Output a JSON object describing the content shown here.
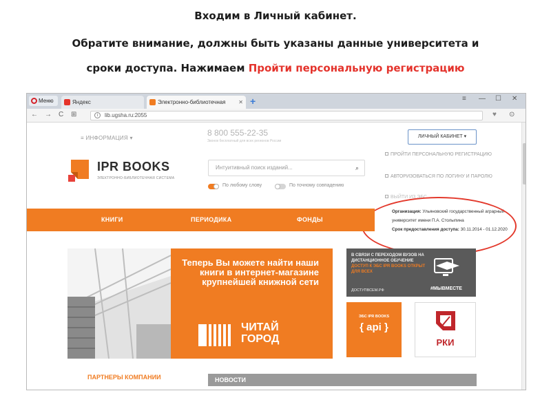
{
  "slide": {
    "line1": "Входим в Личный кабинет.",
    "line2": "Обратите внимание, должны быть указаны данные университета и",
    "line3_plain": "сроки доступа. Нажимаем ",
    "line3_accent": "Пройти персональную регистрацию"
  },
  "browser": {
    "menu_label": "Меню",
    "tabs": [
      {
        "label": "Яндекс",
        "active": false
      },
      {
        "label": "Электронно-библиотечная",
        "active": true
      }
    ],
    "new_tab": "+",
    "url": "lib.ugsha.ru:2055"
  },
  "site": {
    "info_menu": "≡ ИНФОРМАЦИЯ ▾",
    "phone": "8 800 555-22-35",
    "phone_note": "Звонок бесплатный для всех регионов России",
    "cabinet_button": "ЛИЧНЫЙ КАБИНЕТ ▾",
    "logo": "IPR BOOKS",
    "logo_sub": "ЭЛЕКТРОННО-БИБЛИОТЕЧНАЯ СИСТЕМА",
    "search_placeholder": "Интуитивный поиск изданий...",
    "toggle_any": "По любому слову",
    "toggle_exact": "По точному совпадению",
    "dropdown": [
      "ПРОЙТИ ПЕРСОНАЛЬНУЮ РЕГИСТРАЦИЮ",
      "АВТОРИЗОВАТЬСЯ ПО ЛОГИНУ И ПАРОЛЮ",
      "ВЫЙТИ ИЗ ЭБС"
    ],
    "org_label": "Организация:",
    "org_value": "Ульяновский государственный аграрный университет имени П.А. Столыпина",
    "access_label": "Срок предоставления доступа:",
    "access_value": "30.11.2014 - 01.12.2020",
    "menu": [
      "КНИГИ",
      "ПЕРИОДИКА",
      "ФОНДЫ"
    ],
    "banner_head": "Теперь Вы можете найти наши книги в интернет-магазине крупнейшей книжной сети",
    "banner_brand_1": "ЧИТАЙ",
    "banner_brand_2": "ГОРОД",
    "promo_text_1": "В СВЯЗИ С ПЕРЕХОДОМ ВУЗОВ НА ДИСТАНЦИОННОЕ ОБУЧЕНИЕ",
    "promo_text_2": "ДОСТУП К ЭБС IPR BOOKS ОТКРЫТ ДЛЯ ВСЕХ",
    "promo_site": "ДОСТУПВСЕМ.РФ",
    "promo_hash": "#МЫВМЕСТЕ",
    "api_small": "ЭБС IPR BOOKS",
    "api_big": "{ api }",
    "rki_label": "РКИ",
    "partners": "ПАРТНЕРЫ КОМПАНИИ",
    "news": "НОВОСТИ"
  },
  "colors": {
    "accent_orange": "#f07c22",
    "highlight_red": "#e3392c"
  }
}
